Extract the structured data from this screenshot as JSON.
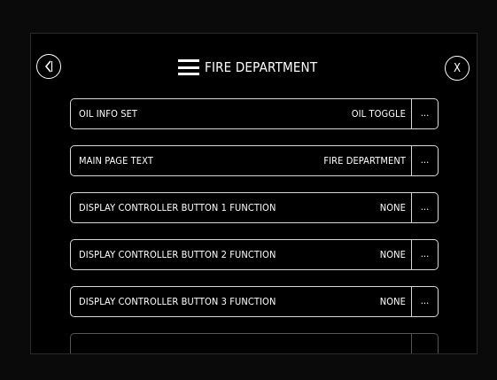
{
  "header": {
    "title": "FIRE DEPARTMENT",
    "back_icon": "back-arrow-icon",
    "close_label": "X",
    "menu_icon": "hamburger-menu-icon"
  },
  "rows": [
    {
      "label": "OIL INFO SET",
      "value": "OIL TOGGLE",
      "button": "..."
    },
    {
      "label": "MAIN PAGE TEXT",
      "value": "FIRE DEPARTMENT",
      "button": "..."
    },
    {
      "label": "DISPLAY CONTROLLER BUTTON 1 FUNCTION",
      "value": "NONE",
      "button": "..."
    },
    {
      "label": "DISPLAY CONTROLLER BUTTON 2 FUNCTION",
      "value": "NONE",
      "button": "..."
    },
    {
      "label": "DISPLAY CONTROLLER BUTTON 3 FUNCTION",
      "value": "NONE",
      "button": "..."
    }
  ],
  "colors": {
    "background": "#000000",
    "foreground": "#ffffff",
    "border": "#d8d8d8"
  }
}
